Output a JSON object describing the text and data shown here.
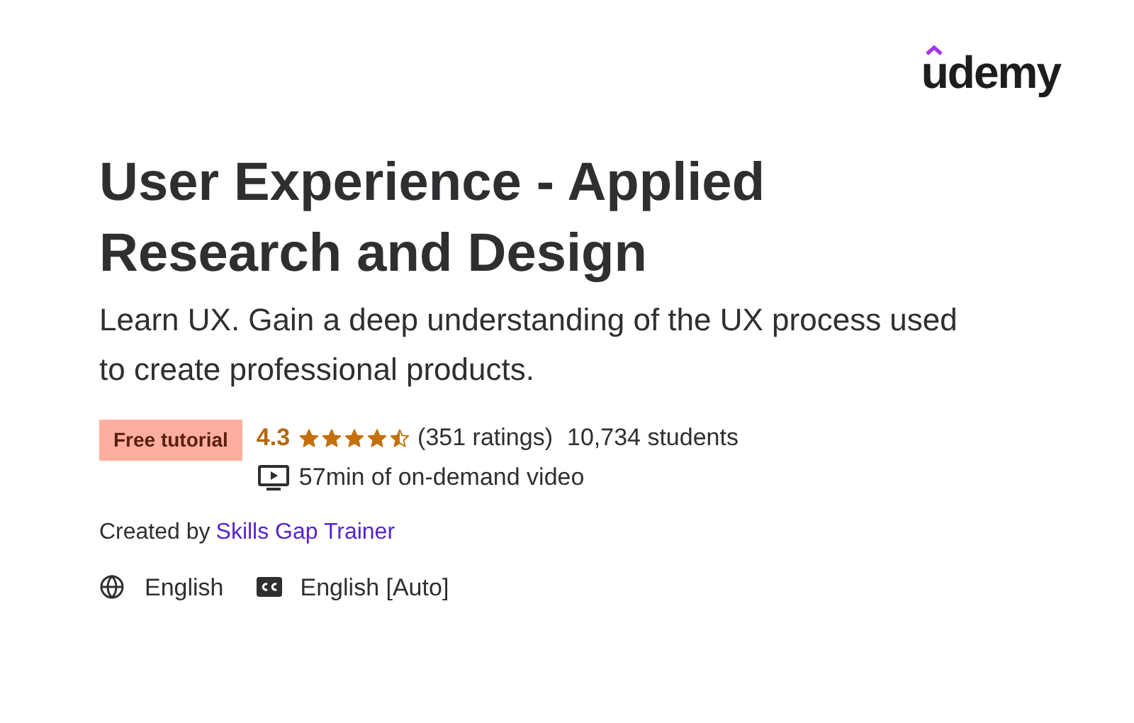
{
  "logo": {
    "text": "udemy"
  },
  "course": {
    "title": "User Experience - Applied Research and Design",
    "subtitle": "Learn UX. Gain a deep understanding of the UX process used to create professional products.",
    "badge": "Free tutorial",
    "rating": "4.3",
    "stars": 4.5,
    "ratings_count": "(351 ratings)",
    "students": "10,734 students",
    "video": "57min of on-demand video",
    "created_by_label": "Created by",
    "instructor": "Skills Gap Trainer",
    "language": "English",
    "captions": "English [Auto]"
  }
}
